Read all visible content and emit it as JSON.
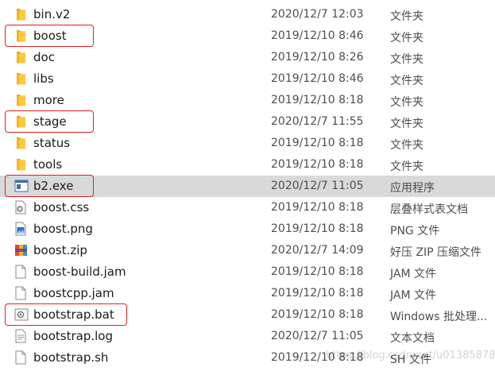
{
  "files": [
    {
      "name": "bin.v2",
      "date": "2020/12/7 12:03",
      "type": "文件夹",
      "icon": "folder-icon"
    },
    {
      "name": "boost",
      "date": "2019/12/10 8:46",
      "type": "文件夹",
      "icon": "folder-icon"
    },
    {
      "name": "doc",
      "date": "2019/12/10 8:26",
      "type": "文件夹",
      "icon": "folder-icon"
    },
    {
      "name": "libs",
      "date": "2019/12/10 8:46",
      "type": "文件夹",
      "icon": "folder-icon"
    },
    {
      "name": "more",
      "date": "2019/12/10 8:18",
      "type": "文件夹",
      "icon": "folder-icon"
    },
    {
      "name": "stage",
      "date": "2020/12/7 11:55",
      "type": "文件夹",
      "icon": "folder-icon"
    },
    {
      "name": "status",
      "date": "2019/12/10 8:18",
      "type": "文件夹",
      "icon": "folder-icon"
    },
    {
      "name": "tools",
      "date": "2019/12/10 8:18",
      "type": "文件夹",
      "icon": "folder-icon"
    },
    {
      "name": "b2.exe",
      "date": "2020/12/7 11:05",
      "type": "应用程序",
      "icon": "exe-icon"
    },
    {
      "name": "boost.css",
      "date": "2019/12/10 8:18",
      "type": "层叠样式表文档",
      "icon": "css-file-icon"
    },
    {
      "name": "boost.png",
      "date": "2019/12/10 8:18",
      "type": "PNG 文件",
      "icon": "image-file-icon"
    },
    {
      "name": "boost.zip",
      "date": "2020/12/7 14:09",
      "type": "好压 ZIP 压缩文件",
      "icon": "zip-archive-icon"
    },
    {
      "name": "boost-build.jam",
      "date": "2019/12/10 8:18",
      "type": "JAM 文件",
      "icon": "file-icon"
    },
    {
      "name": "boostcpp.jam",
      "date": "2019/12/10 8:18",
      "type": "JAM 文件",
      "icon": "file-icon"
    },
    {
      "name": "bootstrap.bat",
      "date": "2019/12/10 8:18",
      "type": "Windows 批处理...",
      "icon": "batch-file-icon"
    },
    {
      "name": "bootstrap.log",
      "date": "2020/12/7 11:05",
      "type": "文本文档",
      "icon": "text-file-icon"
    },
    {
      "name": "bootstrap.sh",
      "date": "2019/12/10 8:18",
      "type": "SH 文件",
      "icon": "file-icon"
    }
  ],
  "selected_file": "b2.exe",
  "highlighted_files": [
    "boost",
    "stage",
    "b2.exe",
    "bootstrap.bat"
  ],
  "watermark": "https://blog.csdn.net/u013858785",
  "colors": {
    "folder": "#ffc83d",
    "selection": "#d9d9d9",
    "highlight_box": "#e02020"
  }
}
